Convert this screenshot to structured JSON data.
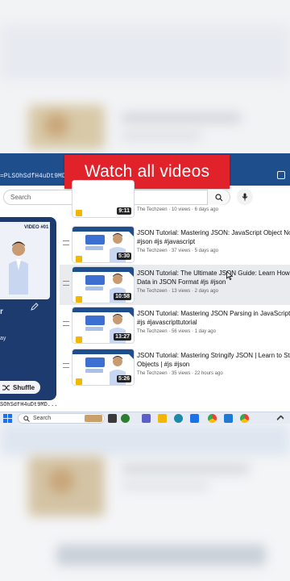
{
  "banner": {
    "text": "Watch all videos"
  },
  "browser": {
    "url": "=PLSOhSdfH4uDt9MD6C"
  },
  "search": {
    "placeholder": "Search"
  },
  "playlist_panel": {
    "video_label": "VIDEO #01",
    "side_text_1": "r",
    "side_text_2": "ay",
    "shuffle_label": "Shuffle",
    "bottom_url": "SOhSdfH4uDt9MD..."
  },
  "videos": [
    {
      "title": "",
      "title2": "",
      "channel": "The Techzeen",
      "views": "10 views",
      "age": "6 days ago",
      "duration": "9:11"
    },
    {
      "title": "JSON Tutorial: Mastering JSON: JavaScript Object Notation",
      "title2": "#json #js #javascript",
      "channel": "The Techzeen",
      "views": "37 views",
      "age": "5 days ago",
      "duration": "5:30"
    },
    {
      "title": "JSON Tutorial: The Ultimate JSON Guide: Learn How to C",
      "title2": "Data in JSON Format #js #json",
      "channel": "The Techzeen",
      "views": "13 views",
      "age": "2 days ago",
      "duration": "10:58"
    },
    {
      "title": "JSON Tutorial: Mastering JSON Parsing in JavaScript | H",
      "title2": "#js #javascripttutorial",
      "channel": "The Techzeen",
      "views": "56 views",
      "age": "1 day ago",
      "duration": "13:27"
    },
    {
      "title": "JSON Tutorial: Mastering Stringify JSON | Learn to String",
      "title2": "Objects | #js #json",
      "channel": "The Techzeen",
      "views": "35 views",
      "age": "22 hours ago",
      "duration": "5:26"
    }
  ],
  "taskbar": {
    "search_label": "Search"
  },
  "colors": {
    "accent_blue": "#1f4e8c",
    "banner_red": "#e2222b"
  }
}
